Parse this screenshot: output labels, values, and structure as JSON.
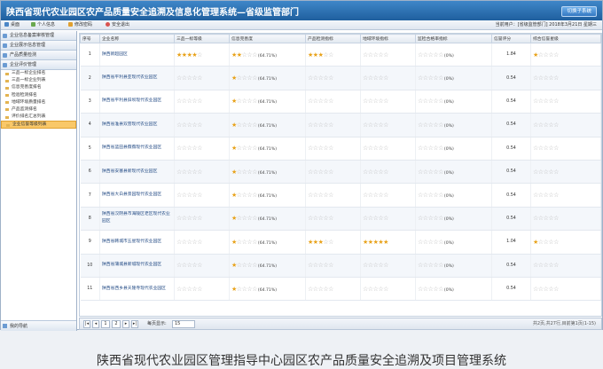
{
  "window": {
    "title": "陕西省现代农业园区农产品质量安全追溯及信息化管理系统—省级监管部门",
    "switch_label": "切换子系统"
  },
  "toolbar": {
    "items": [
      "桌面",
      "个人信息",
      "修改密码",
      "安全退出"
    ],
    "user_info": "当前用户：[省级监管部门] 2018年3月21日 星期三"
  },
  "sidebar": {
    "items": [
      {
        "label": "企业信息备案审核管理"
      },
      {
        "label": "企业展示信息管理"
      },
      {
        "label": "产品质量检测"
      },
      {
        "label": "企业评价管理"
      }
    ],
    "subitems": [
      "三品一标企业排名",
      "三品一标企业列表",
      "信息完善度排名",
      "检验检测排名",
      "地域环境质量排名",
      "产品监测排名",
      "评价排名汇总列表",
      "企业信誉等级列表"
    ],
    "active": "企业信誉等级列表",
    "bottom": "我的导航"
  },
  "table": {
    "columns": [
      "序号",
      "企业名称",
      "三品一标等级",
      "信息完善度",
      "产品检测指标",
      "地域环境指标",
      "监检合格率指标",
      "信誉评分",
      "综合信誉星级"
    ],
    "rows": [
      {
        "no": "1",
        "name": "陕西新超园区",
        "s1": 4,
        "info": 2,
        "p": 3,
        "geo": 0,
        "pass": "(0%)",
        "score": "1.84",
        "total": 1
      },
      {
        "no": "2",
        "name": "陕西省平利县亚现代农业园区",
        "s1": 0,
        "info": 1,
        "p": 0,
        "geo": 0,
        "pass": "(0%)",
        "score": "0.54",
        "total": 0
      },
      {
        "no": "3",
        "name": "陕西省平利县旧坝现代农业园区",
        "s1": 0,
        "info": 1,
        "p": 0,
        "geo": 0,
        "pass": "(0%)",
        "score": "0.54",
        "total": 0
      },
      {
        "no": "4",
        "name": "陕西省淮县双营现代农业园区",
        "s1": 0,
        "info": 1,
        "p": 0,
        "geo": 0,
        "pass": "(0%)",
        "score": "0.54",
        "total": 0
      },
      {
        "no": "5",
        "name": "陕西省蓝田县薇薇现代农业园区",
        "s1": 0,
        "info": 1,
        "p": 0,
        "geo": 0,
        "pass": "(0%)",
        "score": "0.54",
        "total": 0
      },
      {
        "no": "6",
        "name": "陕西省安塞县新现代农业园区",
        "s1": 0,
        "info": 1,
        "p": 0,
        "geo": 0,
        "pass": "(0%)",
        "score": "0.54",
        "total": 0
      },
      {
        "no": "7",
        "name": "陕西省大白县景园现代农业园区",
        "s1": 0,
        "info": 1,
        "p": 0,
        "geo": 0,
        "pass": "(0%)",
        "score": "0.54",
        "total": 0
      },
      {
        "no": "8",
        "name": "陕西省汉阴县市海陵区老区现代农业园区",
        "s1": 0,
        "info": 1,
        "p": 0,
        "geo": 0,
        "pass": "(0%)",
        "score": "0.54",
        "total": 0
      },
      {
        "no": "9",
        "name": "陕西省韩城市五星现代农业园区",
        "s1": 0,
        "info": 1,
        "p": 3,
        "geo": 5,
        "pass": "(0%)",
        "score": "1.04",
        "total": 1
      },
      {
        "no": "10",
        "name": "陕西省蒲城县新城现代农业园区",
        "s1": 0,
        "info": 1,
        "p": 0,
        "geo": 0,
        "pass": "(0%)",
        "score": "0.54",
        "total": 0
      },
      {
        "no": "11",
        "name": "陕西省西乡县天隆寺现代农业园区",
        "s1": 0,
        "info": 1,
        "p": 0,
        "geo": 0,
        "pass": "(0%)",
        "score": "0.54",
        "total": 0
      }
    ],
    "info_pct": "(64.71%)"
  },
  "pager": {
    "page": "1",
    "page2": "2",
    "per_page_label": "每页显示:",
    "per_page": "15",
    "summary": "共2页,共27行,目前第1页(1-15)"
  },
  "caption": "陕西省现代农业园区管理指导中心园区农产品质量安全追溯及项目管理系统",
  "colors": {
    "title": "#2a6db4",
    "star": "#e8a21a",
    "active": "#f9c869"
  }
}
